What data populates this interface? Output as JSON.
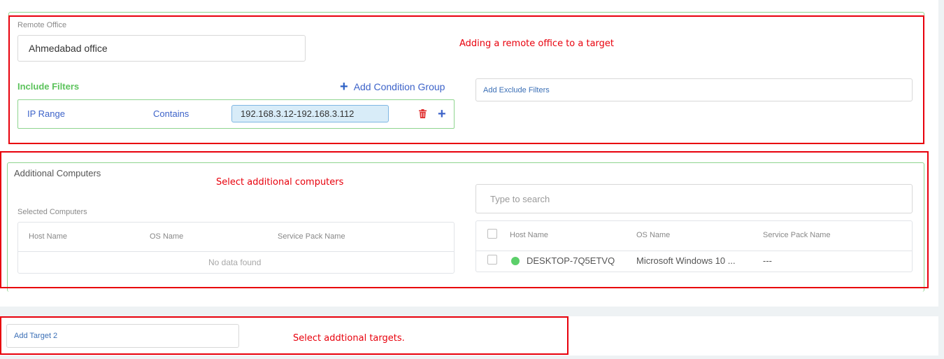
{
  "remote_office": {
    "label": "Remote Office",
    "value": "Ahmedabad office"
  },
  "include_filters": {
    "title": "Include Filters",
    "add_group_label": "Add Condition Group",
    "row": {
      "field": "IP Range",
      "operator": "Contains",
      "value": "192.168.3.12-192.168.3.112"
    }
  },
  "exclude_filters": {
    "placeholder": "Add Exclude Filters"
  },
  "additional_computers": {
    "title": "Additional Computers",
    "selected_label": "Selected Computers",
    "selected_table": {
      "columns": [
        "Host Name",
        "OS Name",
        "Service Pack Name"
      ],
      "empty_text": "No data found"
    },
    "search_placeholder": "Type to search",
    "available_table": {
      "columns": [
        "Host Name",
        "OS Name",
        "Service Pack Name"
      ],
      "rows": [
        {
          "host": "DESKTOP-7Q5ETVQ",
          "os": "Microsoft Windows 10 ...",
          "sp": "---",
          "status_color": "#5ccf6a"
        }
      ]
    }
  },
  "add_target": {
    "placeholder": "Add Target 2"
  },
  "annotations": {
    "remote_office": "Adding a remote office to a target",
    "additional_computers": "Select additional computers",
    "additional_targets": "Select addtional targets."
  },
  "colors": {
    "accent_green": "#8fd58f",
    "link_blue": "#3d63c9",
    "annotation_red": "#e8000c",
    "status_online": "#5ccf6a"
  }
}
